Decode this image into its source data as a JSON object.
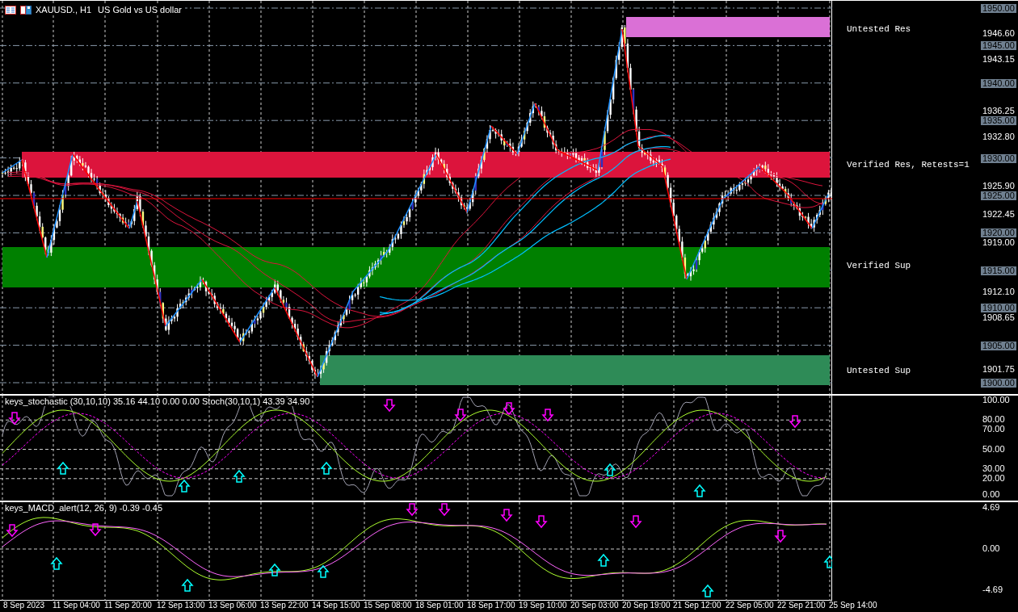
{
  "header": {
    "symbol": "XAUUSD., H1",
    "description": "US Gold vs US dollar"
  },
  "zones": [
    {
      "label": "Untested Res",
      "color": "#da70d6"
    },
    {
      "label": "Verified Res, Retests=1",
      "color": "#dc143c"
    },
    {
      "label": "Verified Sup",
      "color": "#008000"
    },
    {
      "label": "Untested Sup",
      "color": "#2e8b57"
    }
  ],
  "price_axis": [
    {
      "text": "1950.00",
      "kind": "grid"
    },
    {
      "text": "1946.60",
      "kind": "tick"
    },
    {
      "text": "1945.00",
      "kind": "grid"
    },
    {
      "text": "1943.15",
      "kind": "tick"
    },
    {
      "text": "1940.00",
      "kind": "grid"
    },
    {
      "text": "1936.25",
      "kind": "tick"
    },
    {
      "text": "1935.00",
      "kind": "grid"
    },
    {
      "text": "1932.80",
      "kind": "tick"
    },
    {
      "text": "1930.00",
      "kind": "grid"
    },
    {
      "text": "1925.90",
      "kind": "tick"
    },
    {
      "text": "1925.00",
      "kind": "grid"
    },
    {
      "text": "1922.45",
      "kind": "tick"
    },
    {
      "text": "1920.00",
      "kind": "grid"
    },
    {
      "text": "1919.00",
      "kind": "tick"
    },
    {
      "text": "1915.00",
      "kind": "grid"
    },
    {
      "text": "1912.10",
      "kind": "tick"
    },
    {
      "text": "1910.00",
      "kind": "grid"
    },
    {
      "text": "1908.65",
      "kind": "tick"
    },
    {
      "text": "1905.00",
      "kind": "grid"
    },
    {
      "text": "1901.75",
      "kind": "tick"
    },
    {
      "text": "1900.00",
      "kind": "grid"
    }
  ],
  "stochastic": {
    "legend": "keys_stochastic (30,10,10) 35.16 44.10 0.00 0.00 Stoch(30,10,1) 43.39 34.90",
    "axis": [
      "100.00",
      "80.00",
      "70.00",
      "50.00",
      "30.00",
      "20.00",
      "0.00"
    ]
  },
  "macd": {
    "legend": "keys_MACD_alert(12, 26, 9) -0.39 -0.45",
    "axis": [
      "4.69",
      "0.00",
      "-4.69"
    ]
  },
  "time_axis": [
    "8 Sep 2023",
    "11 Sep 04:00",
    "11 Sep 20:00",
    "12 Sep 13:00",
    "13 Sep 06:00",
    "13 Sep 22:00",
    "14 Sep 15:00",
    "15 Sep 08:00",
    "18 Sep 01:00",
    "18 Sep 17:00",
    "19 Sep 10:00",
    "20 Sep 03:00",
    "20 Sep 19:00",
    "21 Sep 12:00",
    "22 Sep 05:00",
    "22 Sep 21:00",
    "25 Sep 14:00"
  ]
}
